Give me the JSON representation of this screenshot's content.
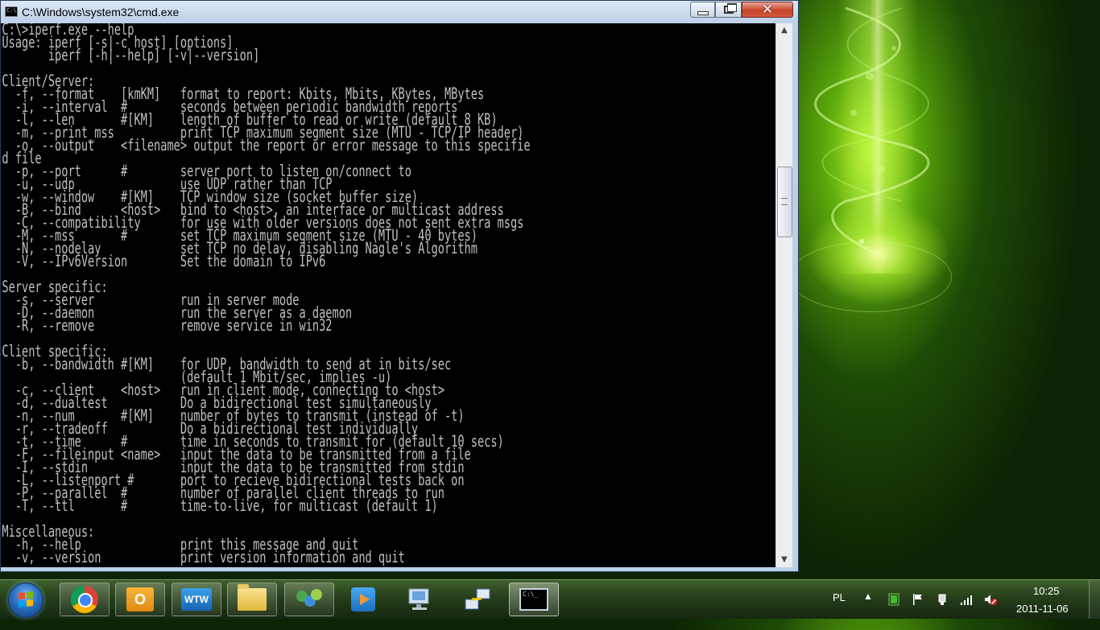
{
  "window": {
    "title": "C:\\Windows\\system32\\cmd.exe",
    "title_icon_text": "C:\\",
    "buttons": {
      "minimize": "minimize",
      "maximize": "maximize",
      "close": "✕"
    }
  },
  "console": {
    "lines": [
      "C:\\>iperf.exe --help",
      "Usage: iperf [-s|-c host] [options]",
      "       iperf [-h|--help] [-v|--version]",
      "",
      "Client/Server:",
      "  -f, --format    [kmKM]   format to report: Kbits, Mbits, KBytes, MBytes",
      "  -i, --interval  #        seconds between periodic bandwidth reports",
      "  -l, --len       #[KM]    length of buffer to read or write (default 8 KB)",
      "  -m, --print_mss          print TCP maximum segment size (MTU - TCP/IP header)",
      "  -o, --output    <filename> output the report or error message to this specifie",
      "d file",
      "  -p, --port      #        server port to listen on/connect to",
      "  -u, --udp                use UDP rather than TCP",
      "  -w, --window    #[KM]    TCP window size (socket buffer size)",
      "  -B, --bind      <host>   bind to <host>, an interface or multicast address",
      "  -C, --compatibility      for use with older versions does not sent extra msgs",
      "  -M, --mss       #        set TCP maximum segment size (MTU - 40 bytes)",
      "  -N, --nodelay            set TCP no delay, disabling Nagle's Algorithm",
      "  -V, --IPv6Version        Set the domain to IPv6",
      "",
      "Server specific:",
      "  -s, --server             run in server mode",
      "  -D, --daemon             run the server as a daemon",
      "  -R, --remove             remove service in win32",
      "",
      "Client specific:",
      "  -b, --bandwidth #[KM]    for UDP, bandwidth to send at in bits/sec",
      "                           (default 1 Mbit/sec, implies -u)",
      "  -c, --client    <host>   run in client mode, connecting to <host>",
      "  -d, --dualtest           Do a bidirectional test simultaneously",
      "  -n, --num       #[KM]    number of bytes to transmit (instead of -t)",
      "  -r, --tradeoff           Do a bidirectional test individually",
      "  -t, --time      #        time in seconds to transmit for (default 10 secs)",
      "  -F, --fileinput <name>   input the data to be transmitted from a file",
      "  -I, --stdin              input the data to be transmitted from stdin",
      "  -L, --listenport #       port to recieve bidirectional tests back on",
      "  -P, --parallel  #        number of parallel client threads to run",
      "  -T, --ttl       #        time-to-live, for multicast (default 1)",
      "",
      "Miscellaneous:",
      "  -h, --help               print this message and quit",
      "  -v, --version            print version information and quit"
    ]
  },
  "taskbar": {
    "apps": [
      {
        "name": "start-button",
        "icon": "windows-logo-icon"
      },
      {
        "name": "chrome",
        "icon": "chrome-icon"
      },
      {
        "name": "outlook",
        "icon": "outlook-icon",
        "label": "O"
      },
      {
        "name": "wtw",
        "icon": "wtw-icon",
        "label": "WTW"
      },
      {
        "name": "explorer",
        "icon": "folder-icon"
      },
      {
        "name": "people",
        "icon": "people-icon"
      },
      {
        "name": "media",
        "icon": "media-player-icon"
      },
      {
        "name": "monitor",
        "icon": "monitor-icon"
      },
      {
        "name": "network",
        "icon": "network-icon"
      },
      {
        "name": "cmd",
        "icon": "cmd-icon",
        "label": "C:\\_"
      }
    ],
    "tray": {
      "language": "PL",
      "show_hidden_arrow": "▲",
      "icons": [
        "battery-icon",
        "flag-icon",
        "usb-icon",
        "signal-icon",
        "volume-muted-icon"
      ],
      "time": "10:25",
      "date": "2011-11-06"
    }
  },
  "colors": {
    "console_bg": "#000000",
    "console_fg": "#c0c0c0",
    "wallpaper_accent": "#b6f02a"
  }
}
